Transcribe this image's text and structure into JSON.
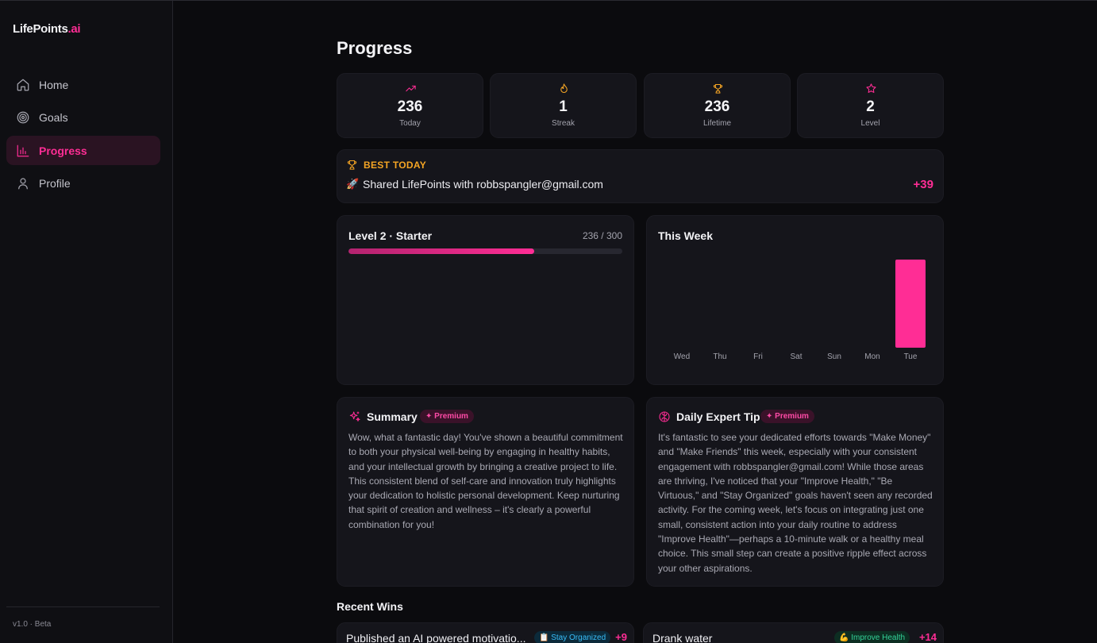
{
  "brand": {
    "name": "LifePoints",
    "suffix": ".ai"
  },
  "nav": [
    {
      "label": "Home",
      "icon": "home-icon"
    },
    {
      "label": "Goals",
      "icon": "target-icon"
    },
    {
      "label": "Progress",
      "icon": "bar-chart-icon",
      "active": true
    },
    {
      "label": "Profile",
      "icon": "user-icon"
    }
  ],
  "version": "v1.0 · Beta",
  "page_title": "Progress",
  "stats": [
    {
      "value": "236",
      "label": "Today",
      "icon": "trending-up-icon",
      "color": "#ff2d95"
    },
    {
      "value": "1",
      "label": "Streak",
      "icon": "flame-icon",
      "color": "#f5a524"
    },
    {
      "value": "236",
      "label": "Lifetime",
      "icon": "trophy-icon",
      "color": "#f5a524"
    },
    {
      "value": "2",
      "label": "Level",
      "icon": "star-icon",
      "color": "#ff2d95"
    }
  ],
  "best_today": {
    "header": "BEST TODAY",
    "emoji": "🚀",
    "text": "Shared LifePoints with robbspangler@gmail.com",
    "points": "+39"
  },
  "level": {
    "title": "Level 2 · Starter",
    "count": "236 / 300",
    "progress": 0.6775
  },
  "this_week": {
    "title": "This Week"
  },
  "chart_data": {
    "type": "bar",
    "categories": [
      "Wed",
      "Thu",
      "Fri",
      "Sat",
      "Sun",
      "Mon",
      "Tue"
    ],
    "values": [
      0,
      0,
      0,
      0,
      0,
      0,
      236
    ],
    "title": "This Week",
    "color": "#ff2d95",
    "grid": false
  },
  "summary": {
    "title": "Summary",
    "badge": "✦ Premium",
    "body": "Wow, what a fantastic day! You've shown a beautiful commitment to both your physical well-being by engaging in healthy habits, and your intellectual growth by bringing a creative project to life. This consistent blend of self-care and innovation truly highlights your dedication to holistic personal development. Keep nurturing that spirit of creation and wellness – it's clearly a powerful combination for you!"
  },
  "tip": {
    "title": "Daily Expert Tip",
    "badge": "✦ Premium",
    "body": "It's fantastic to see your dedicated efforts towards \"Make Money\" and \"Make Friends\" this week, especially with your consistent engagement with robbspangler@gmail.com! While those areas are thriving, I've noticed that your \"Improve Health,\" \"Be Virtuous,\" and \"Stay Organized\" goals haven't seen any recorded activity. For the coming week, let's focus on integrating just one small, consistent action into your daily routine to address \"Improve Health\"—perhaps a 10-minute walk or a healthy meal choice. This small step can create a positive ripple effect across your other aspirations."
  },
  "recent_wins_title": "Recent Wins",
  "recent_wins": [
    {
      "text": "Published an AI powered motivatio...",
      "tag": "📋 Stay Organized",
      "tag_color": "#38bdf8",
      "tag_bg": "#0c2a3a",
      "points": "+9"
    },
    {
      "text": "Drank water",
      "tag": "💪 Improve Health",
      "tag_color": "#34d399",
      "tag_bg": "#0d2e22",
      "points": "+14"
    }
  ]
}
